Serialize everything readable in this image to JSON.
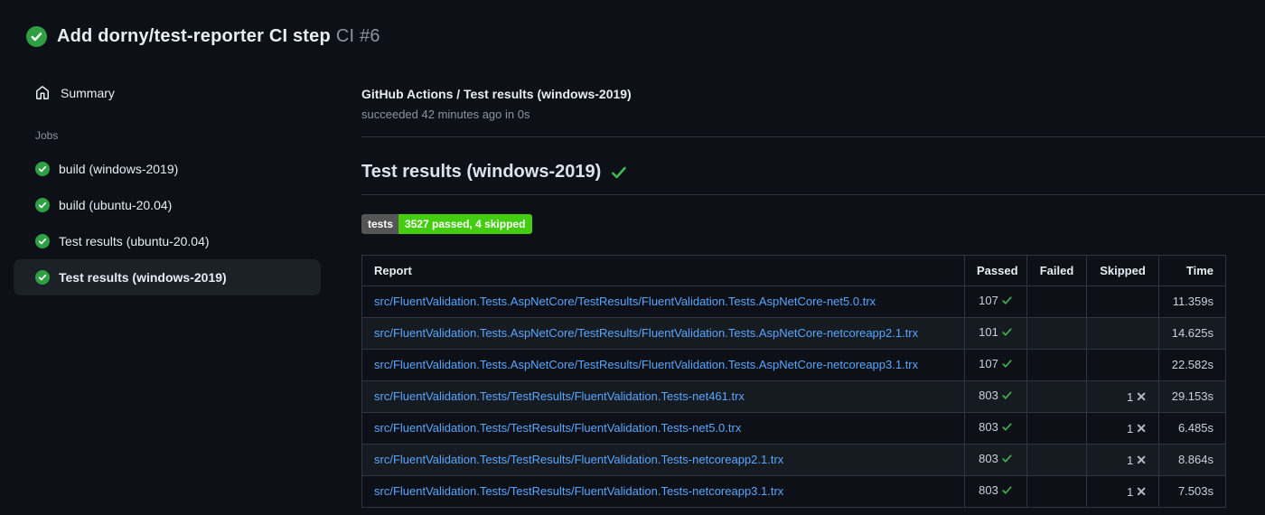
{
  "header": {
    "title": "Add dorny/test-reporter CI step",
    "run_number": "CI #6",
    "status": "success"
  },
  "sidebar": {
    "summary_label": "Summary",
    "jobs_label": "Jobs",
    "jobs": [
      {
        "label": "build (windows-2019)",
        "status": "success",
        "selected": false
      },
      {
        "label": "build (ubuntu-20.04)",
        "status": "success",
        "selected": false
      },
      {
        "label": "Test results (ubuntu-20.04)",
        "status": "success",
        "selected": false
      },
      {
        "label": "Test results (windows-2019)",
        "status": "success",
        "selected": true
      }
    ]
  },
  "main": {
    "check_title": "GitHub Actions / Test results (windows-2019)",
    "check_subtitle": "succeeded 42 minutes ago in 0s",
    "section_heading": "Test results (windows-2019)",
    "badge": {
      "label": "tests",
      "value": "3527 passed, 4 skipped",
      "label_bg": "#555555",
      "value_bg": "#44cc11"
    },
    "table": {
      "columns": [
        "Report",
        "Passed",
        "Failed",
        "Skipped",
        "Time"
      ],
      "rows": [
        {
          "report": "src/FluentValidation.Tests.AspNetCore/TestResults/FluentValidation.Tests.AspNetCore-net5.0.trx",
          "passed": "107",
          "failed": "",
          "skipped": "",
          "time": "11.359s"
        },
        {
          "report": "src/FluentValidation.Tests.AspNetCore/TestResults/FluentValidation.Tests.AspNetCore-netcoreapp2.1.trx",
          "passed": "101",
          "failed": "",
          "skipped": "",
          "time": "14.625s"
        },
        {
          "report": "src/FluentValidation.Tests.AspNetCore/TestResults/FluentValidation.Tests.AspNetCore-netcoreapp3.1.trx",
          "passed": "107",
          "failed": "",
          "skipped": "",
          "time": "22.582s"
        },
        {
          "report": "src/FluentValidation.Tests/TestResults/FluentValidation.Tests-net461.trx",
          "passed": "803",
          "failed": "",
          "skipped": "1",
          "time": "29.153s"
        },
        {
          "report": "src/FluentValidation.Tests/TestResults/FluentValidation.Tests-net5.0.trx",
          "passed": "803",
          "failed": "",
          "skipped": "1",
          "time": "6.485s"
        },
        {
          "report": "src/FluentValidation.Tests/TestResults/FluentValidation.Tests-netcoreapp2.1.trx",
          "passed": "803",
          "failed": "",
          "skipped": "1",
          "time": "8.864s"
        },
        {
          "report": "src/FluentValidation.Tests/TestResults/FluentValidation.Tests-netcoreapp3.1.trx",
          "passed": "803",
          "failed": "",
          "skipped": "1",
          "time": "7.503s"
        }
      ]
    }
  },
  "colors": {
    "page_bg": "#0d1117",
    "row_stripe": "#161b22",
    "table_border": "#30363d",
    "link_blue": "#58a6ff",
    "success_circle": "#2ea043",
    "check_green": "#3fb950",
    "muted_text": "#8b949e",
    "selected_item_bg": "#1c2128"
  }
}
